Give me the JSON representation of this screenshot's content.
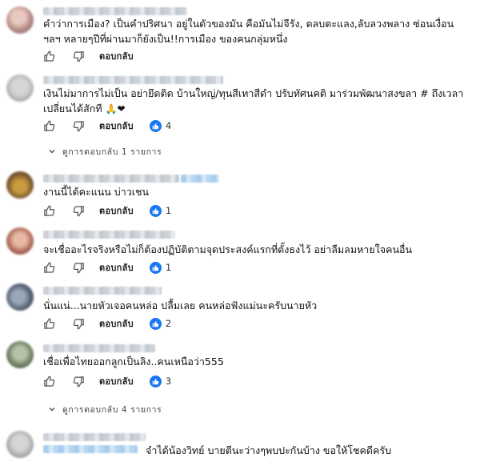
{
  "comments": [
    {
      "text": "คําว่าการเมือง? เป็นคําปริศนา อยู่ในตัวของมัน คือมันไม่จีรัง, ตลบตะแลง,ลับลวงพลาง ซ่อนเงื่อน ฯลฯ หลายๆปีที่ผ่านมาก็ยังเป็น!!การเมือง ของคนกลุ่มหนึ่ง",
      "reply_label": "ตอบกลับ",
      "likes": ""
    },
    {
      "text": "เงินไม่มาการไม่เป็น อย่ายึดติด บ้านใหญ่/ทุนสีเทาสีดํา ปรับทัศนคติ มาร่วมพัฒนาสงขลา # ถึงเวลาเปลี่ยนได้สักที",
      "emoji": "🙏❤",
      "reply_label": "ตอบกลับ",
      "likes": "4"
    },
    {
      "text": "งานนี้ได้คะแนน บ่าวเชน",
      "reply_label": "ตอบกลับ",
      "likes": "1"
    },
    {
      "text": "จะเชื่ออะไรจริงหรือไม่ก็ต้องปฏิบัติตามจุดประสงค์แรกที่ตั้งธงไว้ อย่าลืมลมหายใจคนอื่น",
      "reply_label": "ตอบกลับ",
      "likes": "1"
    },
    {
      "text": "นั่นแน่...นายหัวเจอคนหล่อ ปลื้มเลย คนหล่อฟังแม่นะครับนายหัว",
      "reply_label": "ตอบกลับ",
      "likes": "2"
    },
    {
      "text": "เชื่อเพื่อไทยออกลูกเป็นลิง..คนเหนือว่า555",
      "reply_label": "ตอบกลับ",
      "likes": "3"
    },
    {
      "text": "จําได้น้องวิทย์ บายตีนะว่างๆพบปะกันบ้าง ขอให้โชคดีครับ"
    }
  ],
  "reply_toggles": [
    "ดูการตอบกลับ 1 รายการ",
    "ดูการตอบกลับ 4 รายการ"
  ],
  "colors": {
    "like_badge": "#1877f2",
    "icon_stroke": "#555555"
  }
}
